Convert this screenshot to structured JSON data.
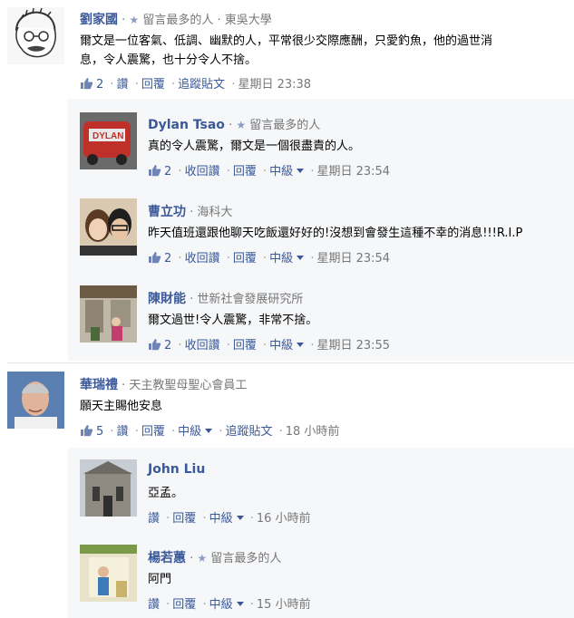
{
  "comments": [
    {
      "name": "劉家國",
      "badge": "留言最多的人",
      "affiliation": "東吳大學",
      "text_lines": [
        "爾文是一位客氣、低調、幽默的人，平常很少交際應酬，只愛釣魚，他的過世消",
        "息，令人震驚，也十分令人不捨。"
      ],
      "likes": "2",
      "actions": [
        "讚",
        "回覆",
        "追蹤貼文"
      ],
      "time": "星期日 23:38",
      "replies": [
        {
          "name": "Dylan Tsao",
          "badge": "留言最多的人",
          "affiliation": "",
          "text": "真的令人震驚，爾文是一個很盡責的人。",
          "likes": "2",
          "actions": [
            "收回讚",
            "回覆",
            "中級"
          ],
          "time": "星期日 23:54"
        },
        {
          "name": "曹立功",
          "badge": "",
          "affiliation": "海科大",
          "text": "昨天值班還跟他聊天吃飯還好好的!沒想到會發生這種不幸的消息!!!R.I.P",
          "likes": "2",
          "actions": [
            "收回讚",
            "回覆",
            "中級"
          ],
          "time": "星期日 23:54"
        },
        {
          "name": "陳財能",
          "badge": "",
          "affiliation": "世新社會發展研究所",
          "text": "爾文過世!令人震驚，非常不捨。",
          "likes": "2",
          "actions": [
            "收回讚",
            "回覆",
            "中級"
          ],
          "time": "星期日 23:55"
        }
      ]
    },
    {
      "name": "華瑞禮",
      "badge": "",
      "affiliation": "天主教聖母聖心會員工",
      "text_lines": [
        "願天主賜他安息"
      ],
      "likes": "5",
      "actions": [
        "讚",
        "回覆",
        "中級",
        "追蹤貼文"
      ],
      "time": "18 小時前",
      "replies": [
        {
          "name": "John Liu",
          "badge": "",
          "affiliation": "",
          "text": "亞孟。",
          "likes": "",
          "actions": [
            "讚",
            "回覆",
            "中級"
          ],
          "time": "16 小時前"
        },
        {
          "name": "楊若蕙",
          "badge": "留言最多的人",
          "affiliation": "",
          "text": "阿門",
          "likes": "",
          "actions": [
            "讚",
            "回覆",
            "中級"
          ],
          "time": "15 小時前"
        }
      ]
    }
  ],
  "colors": {
    "link": "#3b5998",
    "meta": "#777777",
    "reply_bg": "#f6f7f9"
  },
  "icons": {
    "like": "thumbs-up-icon",
    "badge": "star-icon",
    "dropdown": "caret-down-icon"
  }
}
